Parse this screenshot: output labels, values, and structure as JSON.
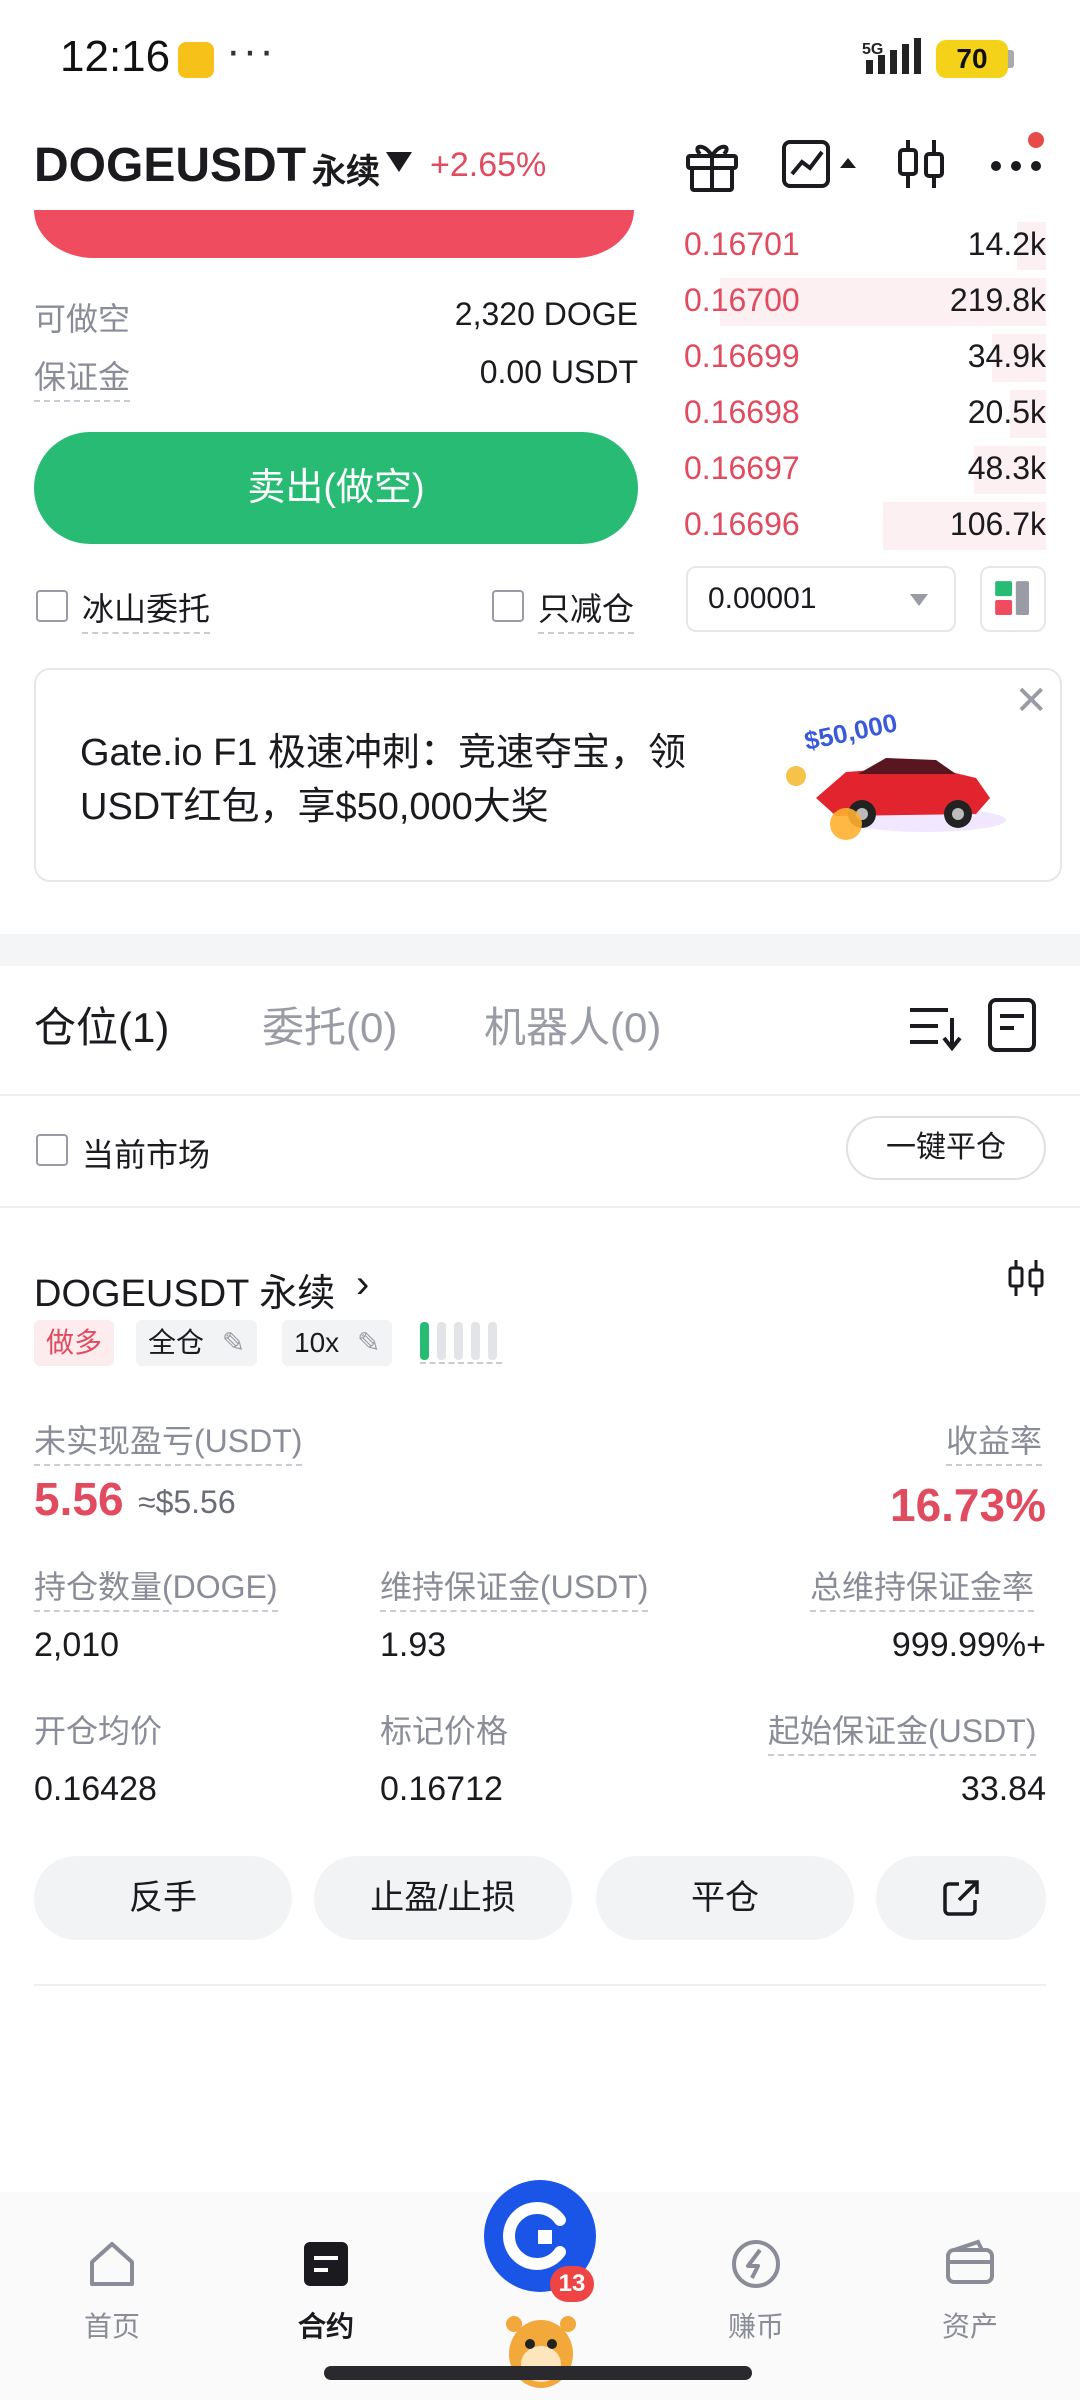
{
  "status_bar": {
    "time": "12:16",
    "dots": "···",
    "network": "5G",
    "battery": "70"
  },
  "header": {
    "symbol": "DOGEUSDT",
    "contract_type": "永续",
    "change": "+2.65%"
  },
  "trade_panel": {
    "short_available_label": "可做空",
    "short_available_value": "2,320 DOGE",
    "margin_label": "保证金",
    "margin_value": "0.00 USDT",
    "sell_button": "卖出(做空)",
    "iceberg_label": "冰山委托",
    "reduce_only_label": "只减仓"
  },
  "order_book": {
    "asks": [
      {
        "price": "0.16701",
        "size": "14.2k",
        "depth": 0.08
      },
      {
        "price": "0.16700",
        "size": "219.8k",
        "depth": 0.9
      },
      {
        "price": "0.16699",
        "size": "34.9k",
        "depth": 0.15
      },
      {
        "price": "0.16698",
        "size": "20.5k",
        "depth": 0.1
      },
      {
        "price": "0.16697",
        "size": "48.3k",
        "depth": 0.2
      },
      {
        "price": "0.16696",
        "size": "106.7k",
        "depth": 0.45
      }
    ],
    "precision": "0.00001"
  },
  "banner": {
    "text": "Gate.io F1 极速冲刺：竞速夺宝，领USDT红包，享$50,000大奖",
    "image_text": "$50,000",
    "close": "✕"
  },
  "tabs": [
    {
      "label": "仓位(1)"
    },
    {
      "label": "委托(0)"
    },
    {
      "label": "机器人(0)"
    }
  ],
  "filter": {
    "current_market_label": "当前市场",
    "close_all_button": "一键平仓"
  },
  "position": {
    "symbol": "DOGEUSDT 永续",
    "chevron": "›",
    "side": "做多",
    "margin_mode": "全仓",
    "leverage": "10x",
    "leverage_level": 0.2,
    "unrealized_pnl_label": "未实现盈亏(USDT)",
    "unrealized_pnl": "5.56",
    "unrealized_pnl_usd": "≈$5.56",
    "roe_label": "收益率",
    "roe": "16.73%",
    "size_label": "持仓数量(DOGE)",
    "size": "2,010",
    "maint_margin_label": "维持保证金(USDT)",
    "maint_margin": "1.93",
    "margin_ratio_label": "总维持保证金率",
    "margin_ratio": "999.99%+",
    "entry_price_label": "开仓均价",
    "entry_price": "0.16428",
    "mark_price_label": "标记价格",
    "mark_price": "0.16712",
    "initial_margin_label": "起始保证金(USDT)",
    "initial_margin": "33.84",
    "actions": {
      "reverse": "反手",
      "tp_sl": "止盈/止损",
      "close": "平仓"
    }
  },
  "bottom_nav": {
    "home": "首页",
    "futures": "合约",
    "earn": "赚币",
    "assets": "资产",
    "badge": "13"
  },
  "colors": {
    "up_green": "#27bb74",
    "down_red": "#e04b5f",
    "brand_blue": "#1b55e8"
  }
}
